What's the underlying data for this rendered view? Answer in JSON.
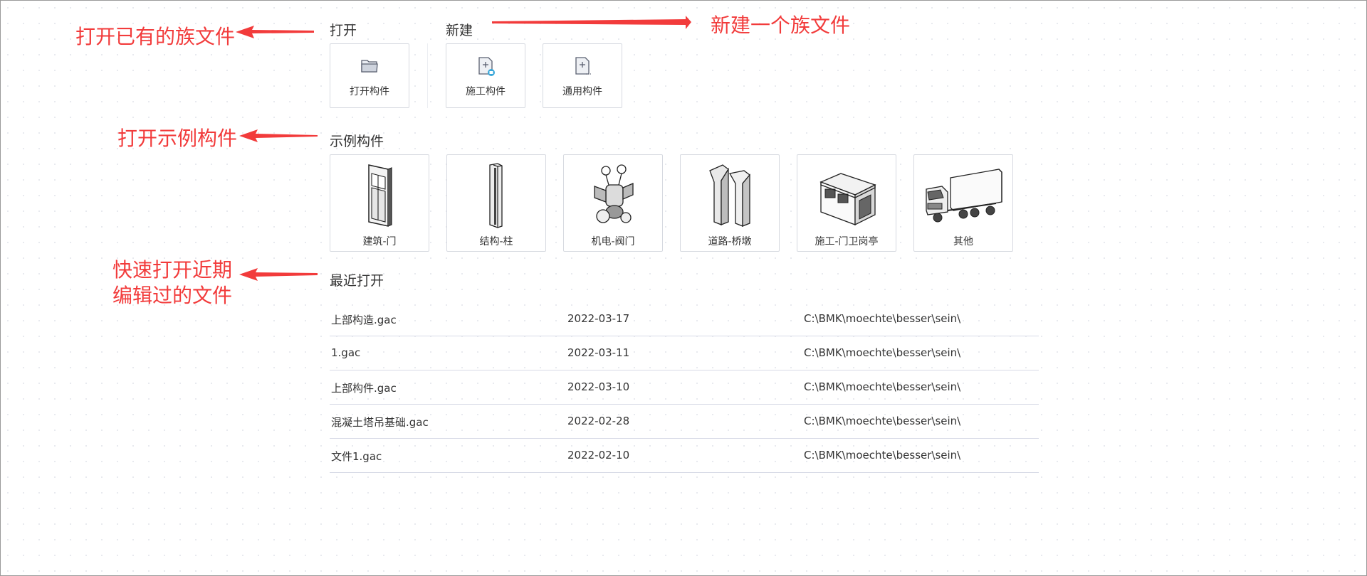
{
  "annotations": {
    "open_existing": "打开已有的族文件",
    "new_family": "新建一个族文件",
    "open_sample": "打开示例构件",
    "recent_line1": "快速打开近期",
    "recent_line2": "编辑过的文件",
    "color": "#f23b3b"
  },
  "open_section": {
    "title": "打开",
    "items": [
      {
        "label": "打开构件",
        "icon": "folder-icon"
      }
    ]
  },
  "new_section": {
    "title": "新建",
    "items": [
      {
        "label": "施工构件",
        "icon": "construction-component-icon"
      },
      {
        "label": "通用构件",
        "icon": "generic-component-icon"
      }
    ]
  },
  "sample_section": {
    "title": "示例构件",
    "items": [
      {
        "label": "建筑-门",
        "icon": "door-icon"
      },
      {
        "label": "结构-柱",
        "icon": "column-icon"
      },
      {
        "label": "机电-阀门",
        "icon": "valve-icon"
      },
      {
        "label": "道路-桥墩",
        "icon": "pier-icon"
      },
      {
        "label": "施工-门卫岗亭",
        "icon": "guard-booth-icon"
      },
      {
        "label": "其他",
        "icon": "truck-icon"
      }
    ]
  },
  "recent_section": {
    "title": "最近打开",
    "rows": [
      {
        "name": "上部构造.gac",
        "date": "2022-03-17",
        "path": "C:\\BMK\\moechte\\besser\\sein\\"
      },
      {
        "name": "1.gac",
        "date": "2022-03-11",
        "path": "C:\\BMK\\moechte\\besser\\sein\\"
      },
      {
        "name": "上部构件.gac",
        "date": "2022-03-10",
        "path": "C:\\BMK\\moechte\\besser\\sein\\"
      },
      {
        "name": "混凝土塔吊基础.gac",
        "date": "2022-02-28",
        "path": "C:\\BMK\\moechte\\besser\\sein\\"
      },
      {
        "name": "文件1.gac",
        "date": "2022-02-10",
        "path": "C:\\BMK\\moechte\\besser\\sein\\"
      }
    ]
  }
}
